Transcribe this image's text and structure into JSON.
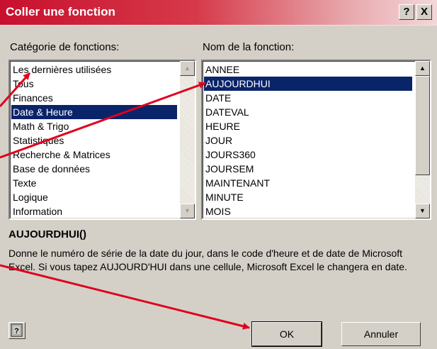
{
  "window": {
    "title": "Coller une fonction",
    "help_button": "?",
    "close_button": "X"
  },
  "categories": {
    "label": "Catégorie de fonctions:",
    "items": [
      "Les dernières utilisées",
      "Tous",
      "Finances",
      "Date & Heure",
      "Math & Trigo",
      "Statistiques",
      "Recherche & Matrices",
      "Base de données",
      "Texte",
      "Logique",
      "Information"
    ],
    "selected": "Date & Heure"
  },
  "functions": {
    "label": "Nom de la fonction:",
    "items": [
      "ANNEE",
      "AUJOURDHUI",
      "DATE",
      "DATEVAL",
      "HEURE",
      "JOUR",
      "JOURS360",
      "JOURSEM",
      "MAINTENANT",
      "MINUTE",
      "MOIS"
    ],
    "selected": "AUJOURDHUI"
  },
  "details": {
    "signature": "AUJOURDHUI()",
    "description": "Donne le numéro de série de la date du jour, dans le code d'heure et de date de Microsoft Excel. Si vous tapez AUJOURD'HUI dans une cellule, Microsoft Excel le changera en date."
  },
  "buttons": {
    "ok": "OK",
    "cancel": "Annuler",
    "office_assistant_icon": "question-mark-icon"
  },
  "colors": {
    "selection": "#0a246a",
    "annotation_arrow": "#e0001b",
    "title_start": "#c8102e"
  }
}
